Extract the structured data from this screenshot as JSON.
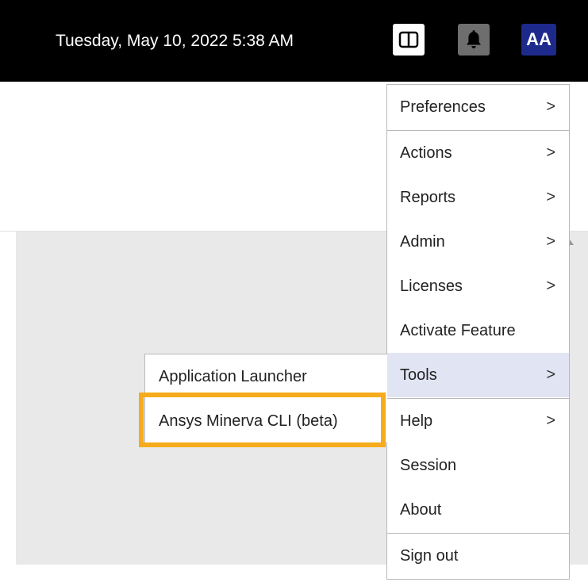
{
  "header": {
    "datetime": "Tuesday, May 10, 2022 5:38 AM",
    "layout_icon": "split-panel-icon",
    "notification_icon": "bell-icon",
    "avatar_initials": "AA",
    "avatar_color": "#1d2a8c"
  },
  "menu": {
    "items": [
      {
        "label": "Preferences",
        "has_submenu": true
      },
      {
        "label": "Actions",
        "has_submenu": true
      },
      {
        "label": "Reports",
        "has_submenu": true
      },
      {
        "label": "Admin",
        "has_submenu": true
      },
      {
        "label": "Licenses",
        "has_submenu": true
      },
      {
        "label": "Activate Feature",
        "has_submenu": false
      },
      {
        "label": "Tools",
        "has_submenu": true,
        "active": true
      },
      {
        "label": "Help",
        "has_submenu": true
      },
      {
        "label": "Session",
        "has_submenu": false
      },
      {
        "label": "About",
        "has_submenu": false
      },
      {
        "label": "Sign out",
        "has_submenu": false
      }
    ],
    "chevron": ">"
  },
  "submenu": {
    "items": [
      {
        "label": "Application Launcher"
      },
      {
        "label": "Ansys Minerva CLI (beta)",
        "highlighted": true
      }
    ],
    "highlight_color": "#f5ab1b"
  }
}
